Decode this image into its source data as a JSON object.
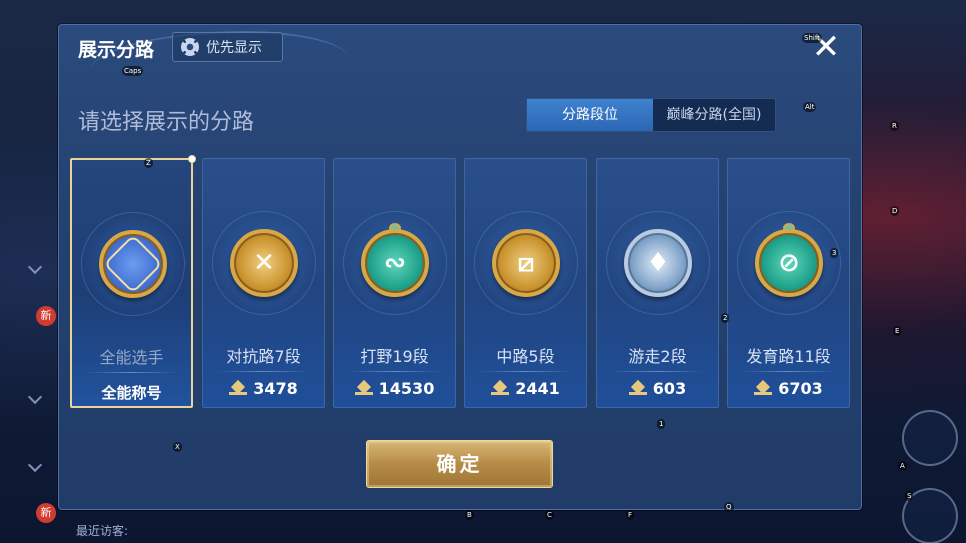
{
  "dialog": {
    "title": "展示分路",
    "pref_button_label": "优先显示",
    "subtitle": "请选择展示的分路",
    "tabs": [
      {
        "label": "分路段位",
        "active": true
      },
      {
        "label": "巅峰分路(全国)",
        "active": false
      }
    ],
    "confirm_label": "确定"
  },
  "cards": [
    {
      "role": "全能选手",
      "value": "全能称号",
      "selected": true,
      "emblem_color": "#3f6fd1",
      "emblem_icon": "crossed-frames-icon"
    },
    {
      "role": "对抗路7段",
      "value": "3478",
      "selected": false,
      "emblem_color": "#c9932e",
      "emblem_icon": "crossed-swords-icon"
    },
    {
      "role": "打野19段",
      "value": "14530",
      "selected": false,
      "emblem_color": "#1ea08a",
      "emblem_icon": "dragon-icon"
    },
    {
      "role": "中路5段",
      "value": "2441",
      "selected": false,
      "emblem_color": "#c9932e",
      "emblem_icon": "slash-frame-icon"
    },
    {
      "role": "游走2段",
      "value": "603",
      "selected": false,
      "emblem_color": "#7fa3c9",
      "emblem_icon": "wings-icon"
    },
    {
      "role": "发育路11段",
      "value": "6703",
      "selected": false,
      "emblem_color": "#1ea08a",
      "emblem_icon": "target-icon"
    }
  ],
  "background": {
    "visitors_label": "最近访客:",
    "new_badge": "新"
  },
  "key_hints": {
    "caps": "Caps",
    "shift": "Shift",
    "alt": "Alt",
    "r": "R",
    "d": "D",
    "e": "E",
    "three": "3",
    "two": "2",
    "one": "1",
    "z": "Z",
    "x": "X",
    "a": "A",
    "s": "S",
    "b": "B",
    "c": "C",
    "f": "F",
    "q": "Q"
  },
  "colors": {
    "accent_blue": "#3f82cf",
    "gold": "#d7a845",
    "selected_border": "#e8d39a"
  }
}
